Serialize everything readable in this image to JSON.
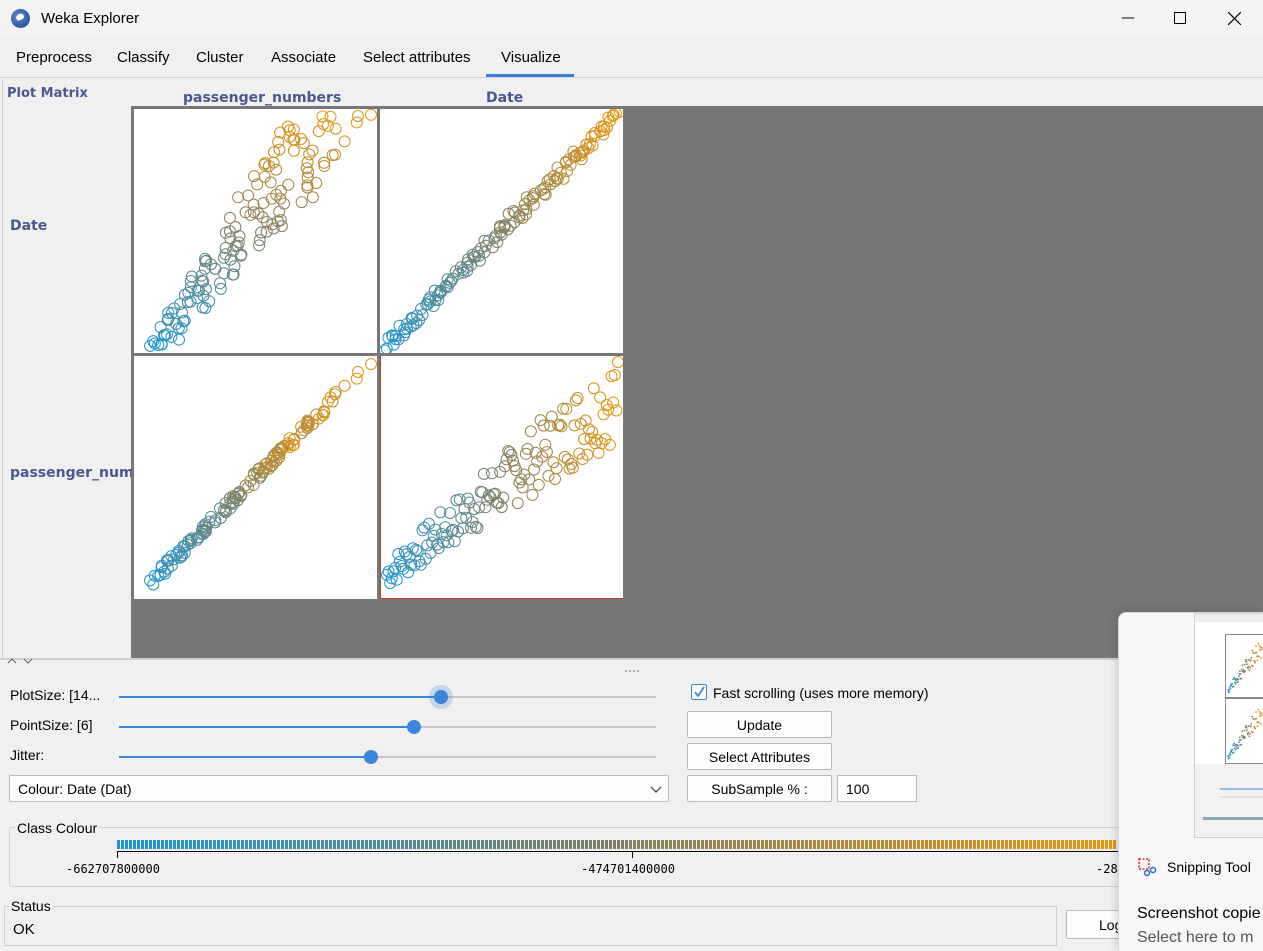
{
  "window": {
    "title": "Weka Explorer"
  },
  "tabs": [
    "Preprocess",
    "Classify",
    "Cluster",
    "Associate",
    "Select attributes",
    "Visualize"
  ],
  "active_tab": "Visualize",
  "plot_matrix": {
    "heading": "Plot Matrix",
    "columns": [
      "passenger_numbers",
      "Date"
    ],
    "rows": [
      "Date",
      "passenger_numb"
    ]
  },
  "controls": {
    "plot_size_label": "PlotSize: [14...",
    "point_size_label": "PointSize: [6]",
    "jitter_label": "Jitter:",
    "plot_size_level": 0.6,
    "point_size_level": 0.55,
    "jitter_level": 0.47,
    "fast_scrolling_label": "Fast scrolling (uses more memory)",
    "fast_scrolling_checked": true,
    "update_label": "Update",
    "select_attributes_label": "Select Attributes",
    "colour_select_value": "Colour: Date  (Dat)",
    "subsample_label": "SubSample % :",
    "subsample_value": "100"
  },
  "class_colour": {
    "title": "Class Colour",
    "ticks": [
      "-662707800000",
      "-474701400000",
      "-28"
    ],
    "colour_low": "#1f97d4",
    "colour_high": "#e8960b"
  },
  "status": {
    "title": "Status",
    "text": "OK",
    "log_button": "Log"
  },
  "notification": {
    "app_name": "Snipping Tool",
    "headline": "Screenshot copie",
    "subtext": "Select here to m"
  }
}
